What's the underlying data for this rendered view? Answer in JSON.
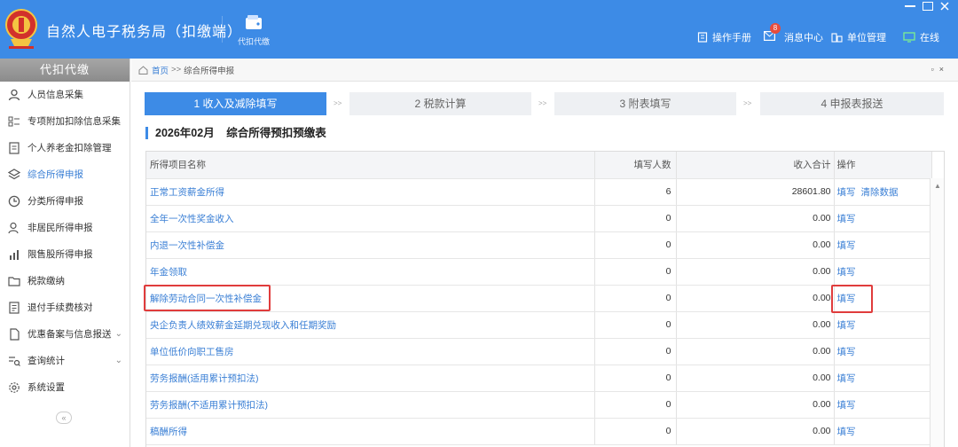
{
  "app": {
    "title": "自然人电子税务局（扣缴端）",
    "nav_label": "代扣代缴"
  },
  "header": {
    "manual": "操作手册",
    "messages": "消息中心",
    "messages_badge": "8",
    "unit_mgmt": "单位管理",
    "status": "在线"
  },
  "sidebar": {
    "title": "代扣代缴",
    "items": [
      {
        "label": "人员信息采集",
        "icon": "person-icon"
      },
      {
        "label": "专项附加扣除信息采集",
        "icon": "list-icon"
      },
      {
        "label": "个人养老金扣除管理",
        "icon": "doc-icon"
      },
      {
        "label": "综合所得申报",
        "icon": "layers-icon"
      },
      {
        "label": "分类所得申报",
        "icon": "clock-icon"
      },
      {
        "label": "非居民所得申报",
        "icon": "person-outline-icon"
      },
      {
        "label": "限售股所得申报",
        "icon": "bar-chart-icon"
      },
      {
        "label": "税款缴纳",
        "icon": "folder-icon"
      },
      {
        "label": "退付手续费核对",
        "icon": "receipt-icon"
      },
      {
        "label": "优惠备案与信息报送",
        "icon": "file-icon"
      },
      {
        "label": "查询统计",
        "icon": "query-icon"
      },
      {
        "label": "系统设置",
        "icon": "settings-icon"
      }
    ],
    "active_index": 3,
    "collapse_label": "«"
  },
  "breadcrumb": {
    "home": "首页",
    "sep": ">>",
    "current": "综合所得申报"
  },
  "steps": [
    {
      "label": "1 收入及减除填写"
    },
    {
      "label": "2 税款计算"
    },
    {
      "label": "3 附表填写"
    },
    {
      "label": "4 申报表报送"
    }
  ],
  "step_sep": ">>",
  "form": {
    "period": "2026年02月",
    "name": "综合所得预扣预缴表"
  },
  "table": {
    "headers": {
      "name": "所得项目名称",
      "count": "填写人数",
      "sum": "收入合计",
      "op": "操作"
    },
    "rows": [
      {
        "name": "正常工资薪金所得",
        "count": "6",
        "sum": "28601.80",
        "ops": [
          "填写",
          "清除数据"
        ]
      },
      {
        "name": "全年一次性奖金收入",
        "count": "0",
        "sum": "0.00",
        "ops": [
          "填写"
        ]
      },
      {
        "name": "内退一次性补偿金",
        "count": "0",
        "sum": "0.00",
        "ops": [
          "填写"
        ]
      },
      {
        "name": "年金领取",
        "count": "0",
        "sum": "0.00",
        "ops": [
          "填写"
        ]
      },
      {
        "name": "解除劳动合同一次性补偿金",
        "count": "0",
        "sum": "0.00",
        "ops": [
          "填写"
        ]
      },
      {
        "name": "央企负责人绩效薪金延期兑现收入和任期奖励",
        "count": "0",
        "sum": "0.00",
        "ops": [
          "填写"
        ]
      },
      {
        "name": "单位低价向职工售房",
        "count": "0",
        "sum": "0.00",
        "ops": [
          "填写"
        ]
      },
      {
        "name": "劳务报酬(适用累计预扣法)",
        "count": "0",
        "sum": "0.00",
        "ops": [
          "填写"
        ]
      },
      {
        "name": "劳务报酬(不适用累计预扣法)",
        "count": "0",
        "sum": "0.00",
        "ops": [
          "填写"
        ]
      },
      {
        "name": "稿酬所得",
        "count": "0",
        "sum": "0.00",
        "ops": [
          "填写"
        ]
      }
    ]
  },
  "colors": {
    "header_bg": "#3d8be6",
    "link": "#3a7fd5",
    "highlight": "#e03c3c"
  }
}
